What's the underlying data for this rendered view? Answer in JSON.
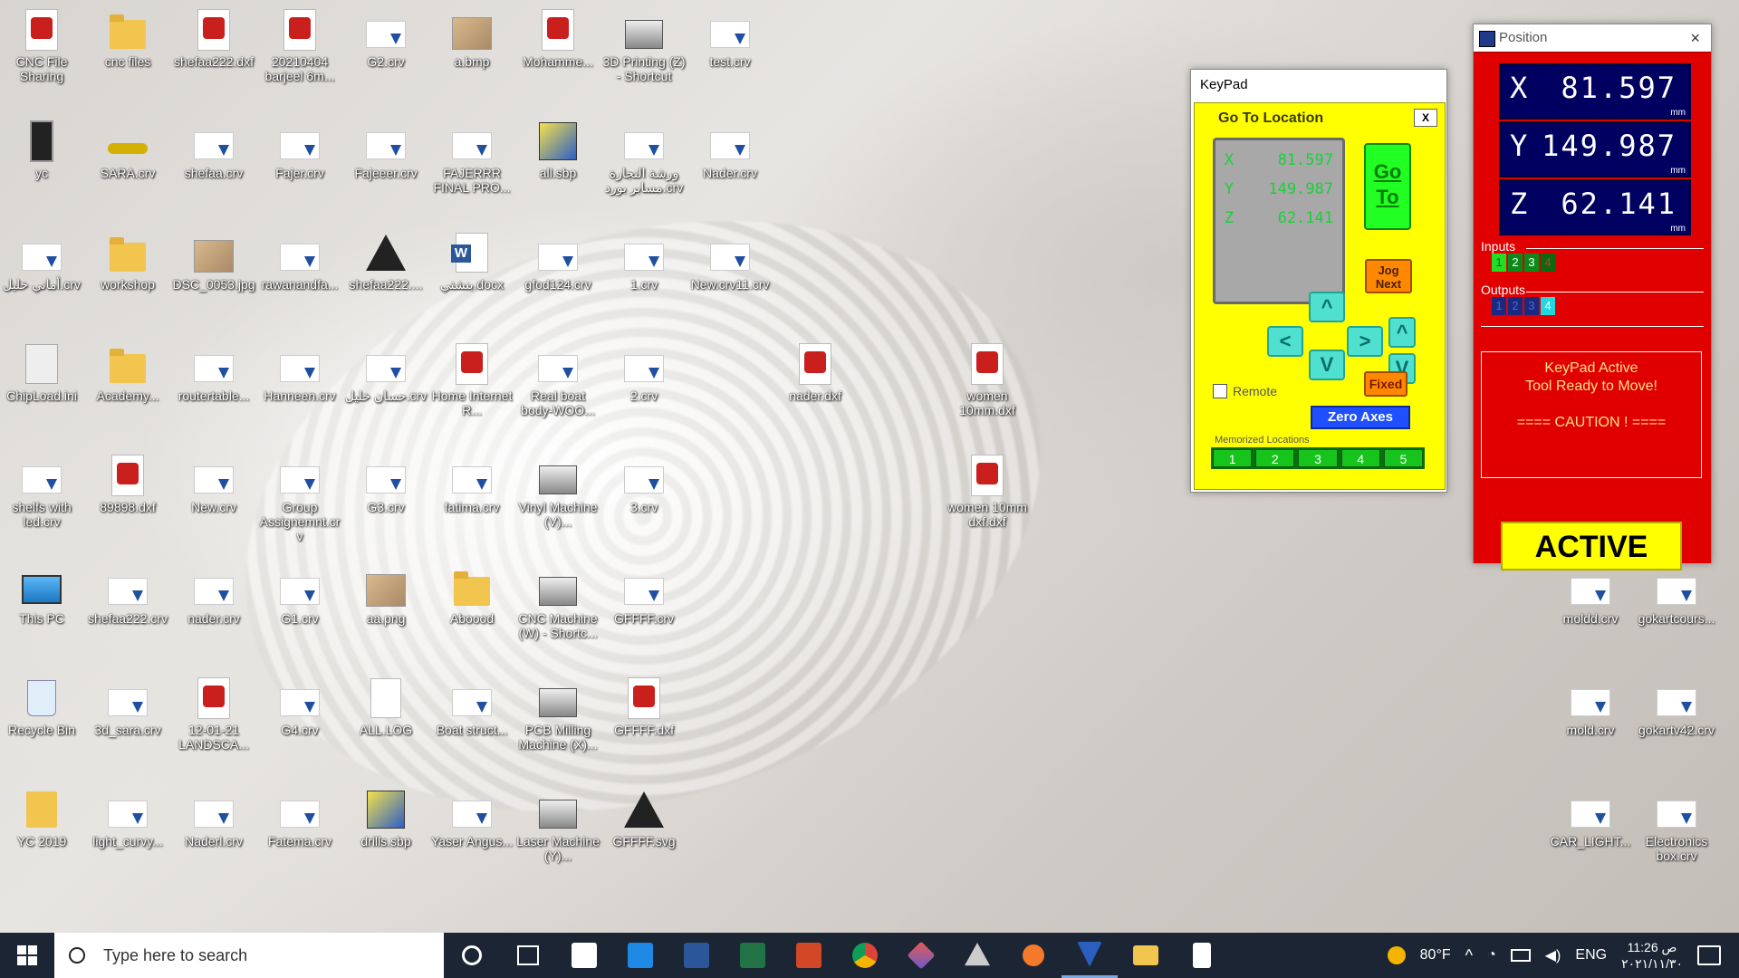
{
  "desktop_icons": [
    {
      "label": "CNC File Sharing",
      "type": "pdf"
    },
    {
      "label": "cnc files",
      "type": "folder"
    },
    {
      "label": "shefaa222.dxf",
      "type": "pdf"
    },
    {
      "label": "20210404 barjeel 6m...",
      "type": "pdf"
    },
    {
      "label": "G2.crv",
      "type": "crv"
    },
    {
      "label": "a.bmp",
      "type": "img"
    },
    {
      "label": "Mohamme...",
      "type": "pdf"
    },
    {
      "label": "3D Printing (Z) - Shortcut",
      "type": "printer"
    },
    {
      "label": "test.crv",
      "type": "crv"
    },
    {
      "label": "yc",
      "type": "yc"
    },
    {
      "label": "SARA.crv",
      "type": "sara"
    },
    {
      "label": "shefaa.crv",
      "type": "crv"
    },
    {
      "label": "Fajer.crv",
      "type": "crv"
    },
    {
      "label": "Fajeeer.crv",
      "type": "crv"
    },
    {
      "label": "FAJERRR FINAL PRO...",
      "type": "crv"
    },
    {
      "label": "all.sbp",
      "type": "sbp"
    },
    {
      "label": "ورشة النجارة مسابر بورد.crv",
      "type": "crv"
    },
    {
      "label": "Nader.crv",
      "type": "crv"
    },
    {
      "label": "أماني خليل.crv",
      "type": "crv"
    },
    {
      "label": "workshop",
      "type": "folder"
    },
    {
      "label": "DSC_0053.jpg",
      "type": "img"
    },
    {
      "label": "rawanandfa...",
      "type": "crv"
    },
    {
      "label": "shefaa222....",
      "type": "ink"
    },
    {
      "label": "بنشتي.docx",
      "type": "word"
    },
    {
      "label": "gfod124.crv",
      "type": "crv"
    },
    {
      "label": "1.crv",
      "type": "crv"
    },
    {
      "label": "New.crv11.crv",
      "type": "crv"
    },
    {
      "label": "ChipLoad.ini",
      "type": "gear"
    },
    {
      "label": "Academy...",
      "type": "folder"
    },
    {
      "label": "routertable...",
      "type": "crv"
    },
    {
      "label": "Hanneen.crv",
      "type": "crv"
    },
    {
      "label": "حسان خليل.crv",
      "type": "crv"
    },
    {
      "label": "Home Internet R...",
      "type": "pdf"
    },
    {
      "label": "Real boat body-WOO...",
      "type": "crv"
    },
    {
      "label": "2.crv",
      "type": "crv"
    },
    {
      "label": "nader.dxf",
      "type": "pdf"
    },
    {
      "label": "women 10mm.dxf",
      "type": "pdf"
    },
    {
      "label": "shelfs with led.crv",
      "type": "crv"
    },
    {
      "label": "89898.dxf",
      "type": "pdf"
    },
    {
      "label": "New.crv",
      "type": "crv"
    },
    {
      "label": "Group Assignemnt.crv",
      "type": "crv"
    },
    {
      "label": "G3.crv",
      "type": "crv"
    },
    {
      "label": "fatima.crv",
      "type": "crv"
    },
    {
      "label": "Vinyl Machine (V)...",
      "type": "printer"
    },
    {
      "label": "3.crv",
      "type": "crv"
    },
    {
      "label": "women 10mm dxf.dxf",
      "type": "pdf"
    },
    {
      "label": "This PC",
      "type": "pc"
    },
    {
      "label": "shefaa222.crv",
      "type": "crv"
    },
    {
      "label": "nader.crv",
      "type": "crv"
    },
    {
      "label": "G1.crv",
      "type": "crv"
    },
    {
      "label": "aa.png",
      "type": "img"
    },
    {
      "label": "Aboood",
      "type": "folder"
    },
    {
      "label": "CNC Machine (W) - Shortc...",
      "type": "printer"
    },
    {
      "label": "GFFFF.crv",
      "type": "crv"
    },
    {
      "label": "Recycle Bin",
      "type": "bin"
    },
    {
      "label": "3d_sara.crv",
      "type": "crv"
    },
    {
      "label": "12-01-21 LANDSCA...",
      "type": "pdf"
    },
    {
      "label": "G4.crv",
      "type": "crv"
    },
    {
      "label": "ALL.LOG",
      "type": "file"
    },
    {
      "label": "Boat struct...",
      "type": "crv"
    },
    {
      "label": "PCB Milling Machine (X)...",
      "type": "printer"
    },
    {
      "label": "GFFFF.dxf",
      "type": "pdf"
    },
    {
      "label": "YC 2019",
      "type": "user"
    },
    {
      "label": "light_curvy...",
      "type": "crv"
    },
    {
      "label": "Naderl.crv",
      "type": "crv"
    },
    {
      "label": "Fatema.crv",
      "type": "crv"
    },
    {
      "label": "drills.sbp",
      "type": "sbp"
    },
    {
      "label": "Yaser Angus...",
      "type": "crv"
    },
    {
      "label": "Laser Machine (Y)...",
      "type": "printer"
    },
    {
      "label": "GFFFF.svg",
      "type": "ink"
    },
    {
      "label": "moldd.crv",
      "type": "crv"
    },
    {
      "label": "gokartcours...",
      "type": "crv"
    },
    {
      "label": "mold.crv",
      "type": "crv"
    },
    {
      "label": "gokartv42.crv",
      "type": "crv"
    },
    {
      "label": "CAR_LIGHT...",
      "type": "crv"
    },
    {
      "label": "Electronics box.crv",
      "type": "crv"
    }
  ],
  "keypad": {
    "title": "KeyPad",
    "heading": "Go To Location",
    "close": "X",
    "lcd": [
      {
        "axis": "X",
        "value": "81.597"
      },
      {
        "axis": "Y",
        "value": "149.987"
      },
      {
        "axis": "Z",
        "value": "62.141"
      }
    ],
    "goto_label": "Go To",
    "jog_label": "Jog Next",
    "arrows": {
      "left": "<",
      "right": ">",
      "up": "^",
      "down": "V",
      "z_up": "^",
      "z_down": "V"
    },
    "fixed_label": "Fixed",
    "remote_label": "Remote",
    "zero_axes_label": "Zero Axes",
    "memorized_label": "Memorized Locations",
    "memory_slots": [
      "1",
      "2",
      "3",
      "4",
      "5"
    ]
  },
  "position": {
    "title": "Position",
    "close": "×",
    "axes": [
      {
        "axis": "X",
        "value": "81.597",
        "unit": "mm"
      },
      {
        "axis": "Y",
        "value": "149.987",
        "unit": "mm"
      },
      {
        "axis": "Z",
        "value": "62.141",
        "unit": "mm"
      }
    ],
    "inputs_label": "Inputs",
    "inputs": [
      "1",
      "2",
      "3",
      "4"
    ],
    "outputs_label": "Outputs",
    "outputs": [
      "1",
      "2",
      "3",
      "4"
    ],
    "status_line1": "KeyPad Active",
    "status_line2": "Tool Ready to Move!",
    "status_line3": "==== CAUTION ! ====",
    "active_label": "ACTIVE"
  },
  "taskbar": {
    "search_placeholder": "Type here to search",
    "weather": "80°F",
    "language": "ENG",
    "time": "11:26 ص",
    "date": "٢٠٢١/١١/٣٠"
  }
}
